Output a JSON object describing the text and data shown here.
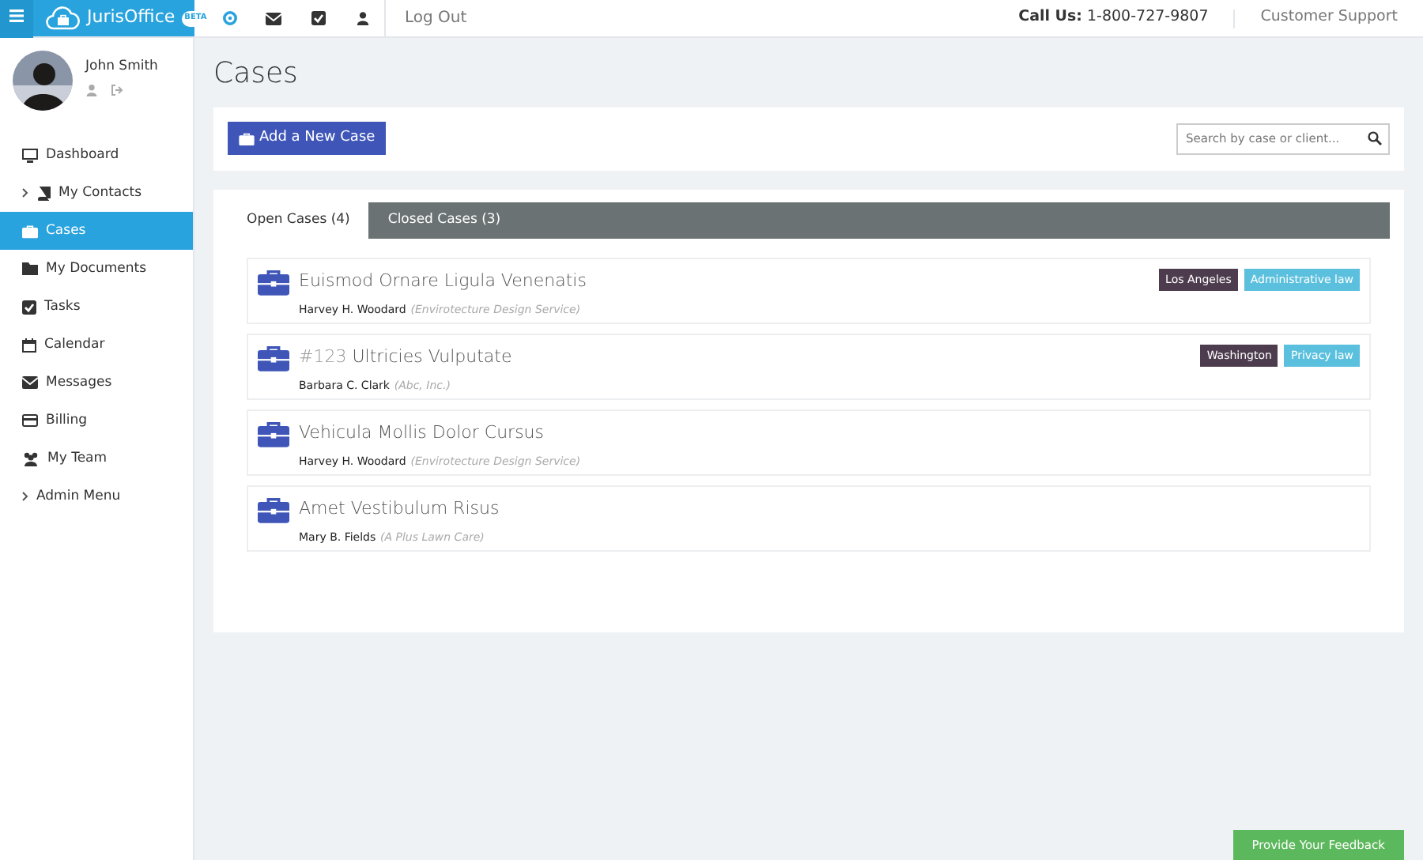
{
  "brand": {
    "name": "JurisOffice",
    "badge": "BETA"
  },
  "topbar": {
    "logout": "Log Out",
    "call_label": "Call Us:",
    "phone": "1-800-727-9807",
    "support": "Customer Support"
  },
  "user": {
    "name": "John Smith"
  },
  "sidebar": {
    "items": [
      {
        "label": "Dashboard",
        "submenu": false,
        "selected": false
      },
      {
        "label": "My Contacts",
        "submenu": true,
        "selected": false
      },
      {
        "label": "Cases",
        "submenu": false,
        "selected": true
      },
      {
        "label": "My Documents",
        "submenu": false,
        "selected": false
      },
      {
        "label": "Tasks",
        "submenu": false,
        "selected": false
      },
      {
        "label": "Calendar",
        "submenu": false,
        "selected": false
      },
      {
        "label": "Messages",
        "submenu": false,
        "selected": false
      },
      {
        "label": "Billing",
        "submenu": false,
        "selected": false
      },
      {
        "label": "My Team",
        "submenu": false,
        "selected": false
      },
      {
        "label": "Admin Menu",
        "submenu": true,
        "selected": false
      }
    ]
  },
  "page": {
    "title": "Cases",
    "add_button": "Add a New Case",
    "search": {
      "placeholder": "Search by case or client..."
    }
  },
  "tabs": [
    {
      "label": "Open Cases (4)",
      "selected": true
    },
    {
      "label": "Closed Cases (3)",
      "selected": false
    }
  ],
  "cases": [
    {
      "title": "Euismod Ornare Ligula Venenatis",
      "client": "Harvey H. Woodard",
      "company": "(Envirotecture Design Service)",
      "tags": [
        {
          "label": "Los Angeles",
          "color": "#4d3c4d"
        },
        {
          "label": "Administrative law",
          "color": "#5bc0de"
        }
      ]
    },
    {
      "number": "#123",
      "title": "Ultricies Vulputate",
      "client": "Barbara C. Clark",
      "company": "(Abc, Inc.)",
      "tags": [
        {
          "label": "Washington",
          "color": "#4d3c4d"
        },
        {
          "label": "Privacy law",
          "color": "#5bc0de"
        }
      ]
    },
    {
      "title": "Vehicula Mollis Dolor Cursus",
      "client": "Harvey H. Woodard",
      "company": "(Envirotecture Design Service)"
    },
    {
      "title": "Amet Vestibulum Risus",
      "client": "Mary B. Fields",
      "company": "(A Plus Lawn Care)"
    }
  ],
  "feedback_button": "Provide Your Feedback"
}
